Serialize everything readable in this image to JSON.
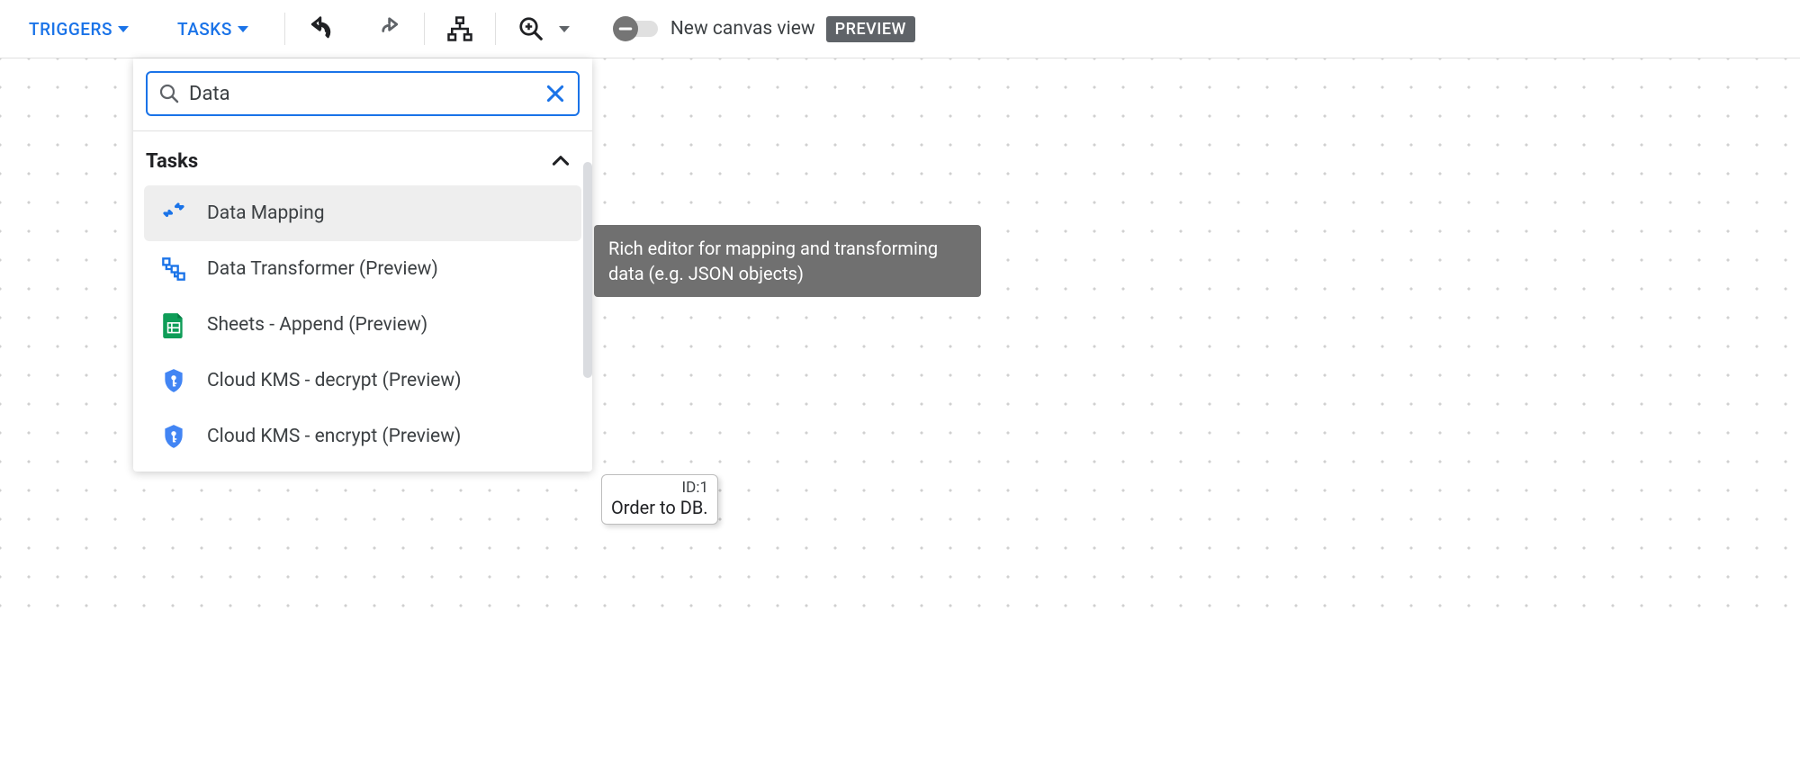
{
  "toolbar": {
    "triggers": "TRIGGERS",
    "tasks": "TASKS",
    "canvas_view_label": "New canvas view",
    "preview_badge": "PREVIEW"
  },
  "search": {
    "value": "Data"
  },
  "section": {
    "title": "Tasks"
  },
  "tasks": [
    {
      "label": "Data Mapping",
      "icon": "data-mapping"
    },
    {
      "label": "Data Transformer (Preview)",
      "icon": "data-transformer"
    },
    {
      "label": "Sheets - Append (Preview)",
      "icon": "sheets"
    },
    {
      "label": "Cloud KMS - decrypt (Preview)",
      "icon": "kms"
    },
    {
      "label": "Cloud KMS - encrypt (Preview)",
      "icon": "kms"
    }
  ],
  "tooltip": "Rich editor for mapping and transforming data (e.g. JSON objects)",
  "canvas_node": {
    "id": "ID:1",
    "label": "Order to DB."
  }
}
